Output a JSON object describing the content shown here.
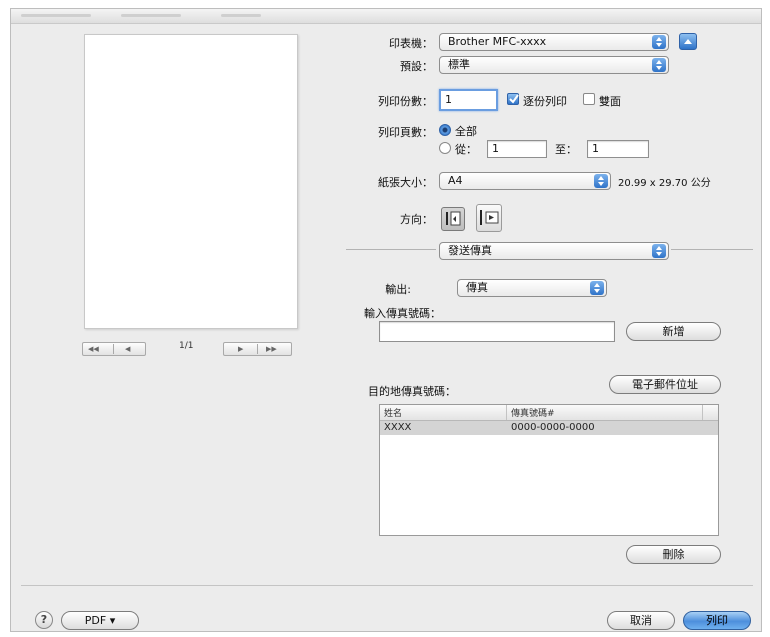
{
  "labels": {
    "printer": "印表機：",
    "presets": "預設：",
    "copies": "列印份數：",
    "pages": "列印頁數：",
    "paper_size": "紙張大小：",
    "orientation": "方向：",
    "output": "輸出:",
    "enter_fax": "輸入傳真號碼：",
    "destination": "目的地傳真號碼："
  },
  "printer": {
    "value": "Brother MFC-xxxx"
  },
  "presets": {
    "value": "標準"
  },
  "copies": {
    "value": "1",
    "collated_label": "逐份列印",
    "collated_checked": true,
    "two_sided_label": "雙面",
    "two_sided_checked": false
  },
  "pages": {
    "all_label": "全部",
    "from_label": "從：",
    "from_value": "1",
    "to_label": "至：",
    "to_value": "1",
    "selected": "all"
  },
  "paper_size": {
    "value": "A4",
    "dimensions": "20.99 x 29.70 公分"
  },
  "section": {
    "value": "發送傳真"
  },
  "output": {
    "value": "傳真"
  },
  "fax": {
    "input_value": "",
    "add_button": "新增"
  },
  "address_button": "電子郵件位址",
  "table": {
    "columns": [
      "姓名",
      "傳真號碼#"
    ],
    "rows": [
      {
        "name": "XXXX",
        "number": "0000-0000-0000"
      }
    ]
  },
  "delete_button": "刪除",
  "preview": {
    "page_count": "1/1"
  },
  "bottom": {
    "pdf_button": "PDF ▾",
    "cancel_button": "取消",
    "print_button": "列印",
    "help": "?"
  },
  "colors": {
    "accent": "#2f73c8",
    "dialog_bg": "#ececec"
  }
}
